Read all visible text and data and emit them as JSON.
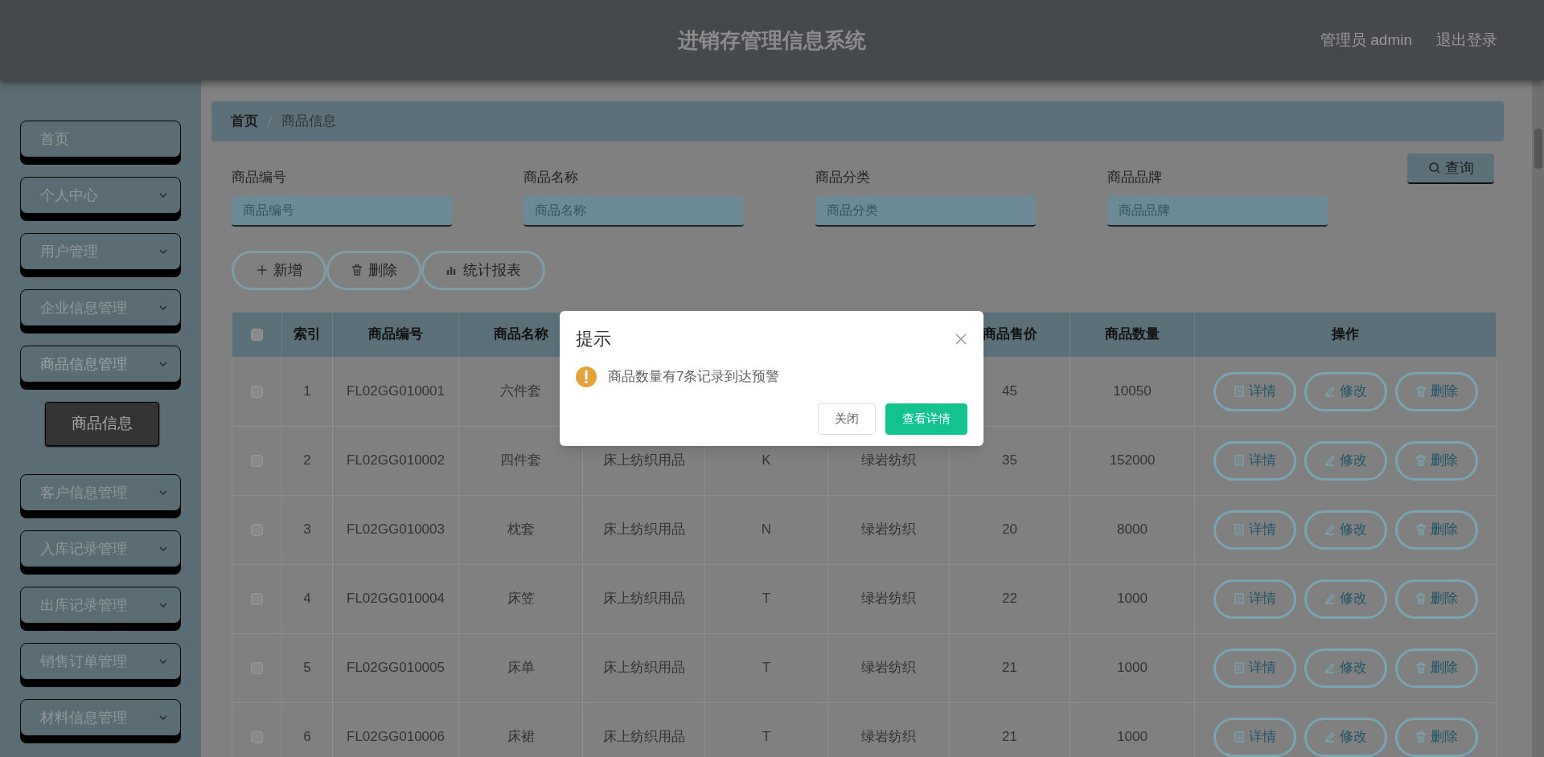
{
  "header": {
    "title": "进销存管理信息系统",
    "user": "管理员 admin",
    "logout": "退出登录"
  },
  "sidebar": {
    "items": [
      {
        "kind": "link",
        "label": "首页"
      },
      {
        "kind": "menu",
        "label": "个人中心",
        "expanded": false
      },
      {
        "kind": "menu",
        "label": "用户管理",
        "expanded": false
      },
      {
        "kind": "menu",
        "label": "企业信息管理",
        "expanded": false
      },
      {
        "kind": "menu",
        "label": "商品信息管理",
        "expanded": true,
        "children": [
          {
            "label": "商品信息",
            "selected": true
          }
        ]
      },
      {
        "kind": "menu",
        "label": "客户信息管理",
        "expanded": false
      },
      {
        "kind": "menu",
        "label": "入库记录管理",
        "expanded": false
      },
      {
        "kind": "menu",
        "label": "出库记录管理",
        "expanded": false
      },
      {
        "kind": "menu",
        "label": "销售订单管理",
        "expanded": false
      },
      {
        "kind": "menu",
        "label": "材料信息管理",
        "expanded": false
      }
    ]
  },
  "breadcrumb": [
    "首页",
    "商品信息"
  ],
  "filters": [
    {
      "label": "商品编号",
      "placeholder": "商品编号"
    },
    {
      "label": "商品名称",
      "placeholder": "商品名称"
    },
    {
      "label": "商品分类",
      "placeholder": "商品分类"
    },
    {
      "label": "商品品牌",
      "placeholder": "商品品牌"
    }
  ],
  "query_button": "查询",
  "toolbar": [
    {
      "kind": "add",
      "label": "新增"
    },
    {
      "kind": "delete",
      "label": "删除"
    },
    {
      "kind": "chart",
      "label": "统计报表"
    }
  ],
  "table": {
    "all_checked": false,
    "columns": [
      "索引",
      "商品编号",
      "商品名称",
      "",
      "",
      "",
      "商品售价",
      "商品数量",
      "操作"
    ],
    "rows": [
      {
        "checked": false,
        "index": "1",
        "code": "FL02GG010001",
        "name": "六件套",
        "price": "45",
        "quantity": "10050",
        "actions": [
          "详情",
          "修改",
          "删除"
        ]
      },
      {
        "checked": false,
        "index": "2",
        "code": "FL02GG010002",
        "name": "四件套",
        "column_5": "床上纺织用品",
        "column_6": "K",
        "column_7": "绿岩纺织",
        "price": "35",
        "quantity": "152000",
        "actions": [
          "详情",
          "修改",
          "删除"
        ]
      },
      {
        "checked": false,
        "index": "3",
        "code": "FL02GG010003",
        "name": "枕套",
        "column_5": "床上纺织用品",
        "column_6": "N",
        "column_7": "绿岩纺织",
        "price": "20",
        "quantity": "8000",
        "actions": [
          "详情",
          "修改",
          "删除"
        ]
      },
      {
        "checked": false,
        "index": "4",
        "code": "FL02GG010004",
        "name": "床笠",
        "column_5": "床上纺织用品",
        "column_6": "T",
        "column_7": "绿岩纺织",
        "price": "22",
        "quantity": "1000",
        "actions": [
          "详情",
          "修改",
          "删除"
        ]
      },
      {
        "checked": false,
        "index": "5",
        "code": "FL02GG010005",
        "name": "床单",
        "column_5": "床上纺织用品",
        "column_6": "T",
        "column_7": "绿岩纺织",
        "price": "21",
        "quantity": "1000",
        "actions": [
          "详情",
          "修改",
          "删除"
        ]
      },
      {
        "checked": false,
        "index": "6",
        "code": "FL02GG010006",
        "name": "床裙",
        "column_5": "床上纺织用品",
        "column_6": "T",
        "column_7": "绿岩纺织",
        "price": "21",
        "quantity": "1000",
        "actions": [
          "详情",
          "修改",
          "删除"
        ]
      }
    ]
  },
  "dialog": {
    "title": "提示",
    "message": "商品数量有7条记录到达预警",
    "buttons": [
      {
        "kind": "secondary",
        "label": "关闭"
      },
      {
        "kind": "primary",
        "label": "查看详情"
      }
    ]
  }
}
